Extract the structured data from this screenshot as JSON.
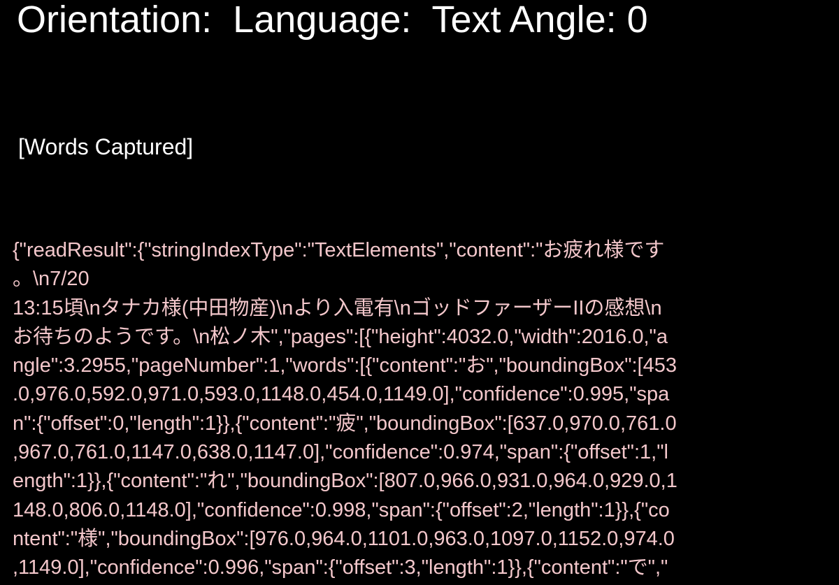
{
  "header": {
    "text": "Orientation:  Language:  Text Angle: 0"
  },
  "section": {
    "label": "[Words Captured]"
  },
  "payload": {
    "lines": [
      "{\"readResult\":{\"stringIndexType\":\"TextElements\",\"content\":\"お疲れ様です",
      "。\\n7/20",
      "13:15頃\\nタナカ様(中田物産)\\nより入電有\\nゴッドファーザーIIの感想\\n",
      "お待ちのようです。\\n松ノ木\",\"pages\":[{\"height\":4032.0,\"width\":2016.0,\"a",
      "ngle\":3.2955,\"pageNumber\":1,\"words\":[{\"content\":\"お\",\"boundingBox\":[453",
      ".0,976.0,592.0,971.0,593.0,1148.0,454.0,1149.0],\"confidence\":0.995,\"spa",
      "n\":{\"offset\":0,\"length\":1}},{\"content\":\"疲\",\"boundingBox\":[637.0,970.0,761.0",
      ",967.0,761.0,1147.0,638.0,1147.0],\"confidence\":0.974,\"span\":{\"offset\":1,\"l",
      "ength\":1}},{\"content\":\"れ\",\"boundingBox\":[807.0,966.0,931.0,964.0,929.0,1",
      "148.0,806.0,1148.0],\"confidence\":0.998,\"span\":{\"offset\":2,\"length\":1}},{\"co",
      "ntent\":\"様\",\"boundingBox\":[976.0,964.0,1101.0,963.0,1097.0,1152.0,974.0",
      ",1149.0],\"confidence\":0.996,\"span\":{\"offset\":3,\"length\":1}},{\"content\":\"で\",\""
    ]
  },
  "colors": {
    "background": "#000000",
    "header_text": "#ffffff",
    "payload_text": "#f3c7cb"
  }
}
